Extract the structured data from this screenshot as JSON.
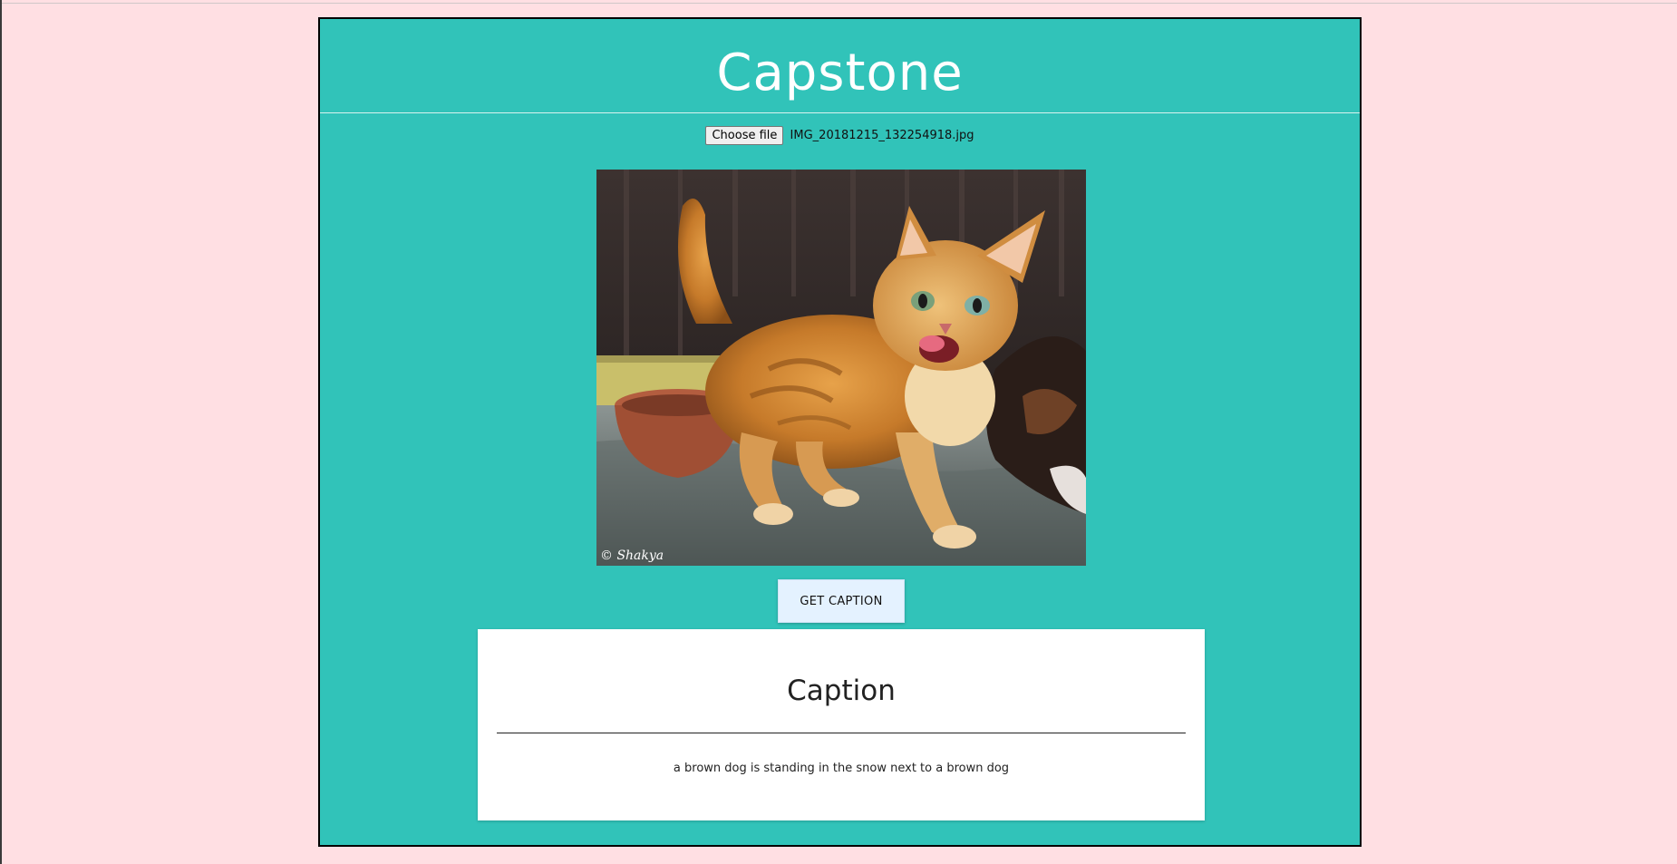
{
  "app": {
    "title": "Capstone"
  },
  "upload": {
    "choose_label": "Choose file",
    "file_name": "IMG_20181215_132254918.jpg"
  },
  "photo": {
    "watermark": "© Shakya",
    "description": "orange kitten"
  },
  "actions": {
    "get_caption_label": "GET CAPTION"
  },
  "caption": {
    "heading": "Caption",
    "text": "a brown dog is standing in the snow next to a brown dog"
  },
  "colors": {
    "page_bg": "#ffdfe3",
    "app_bg": "#31c3b9",
    "button_bg": "#e4f2ff",
    "card_bg": "#ffffff"
  }
}
